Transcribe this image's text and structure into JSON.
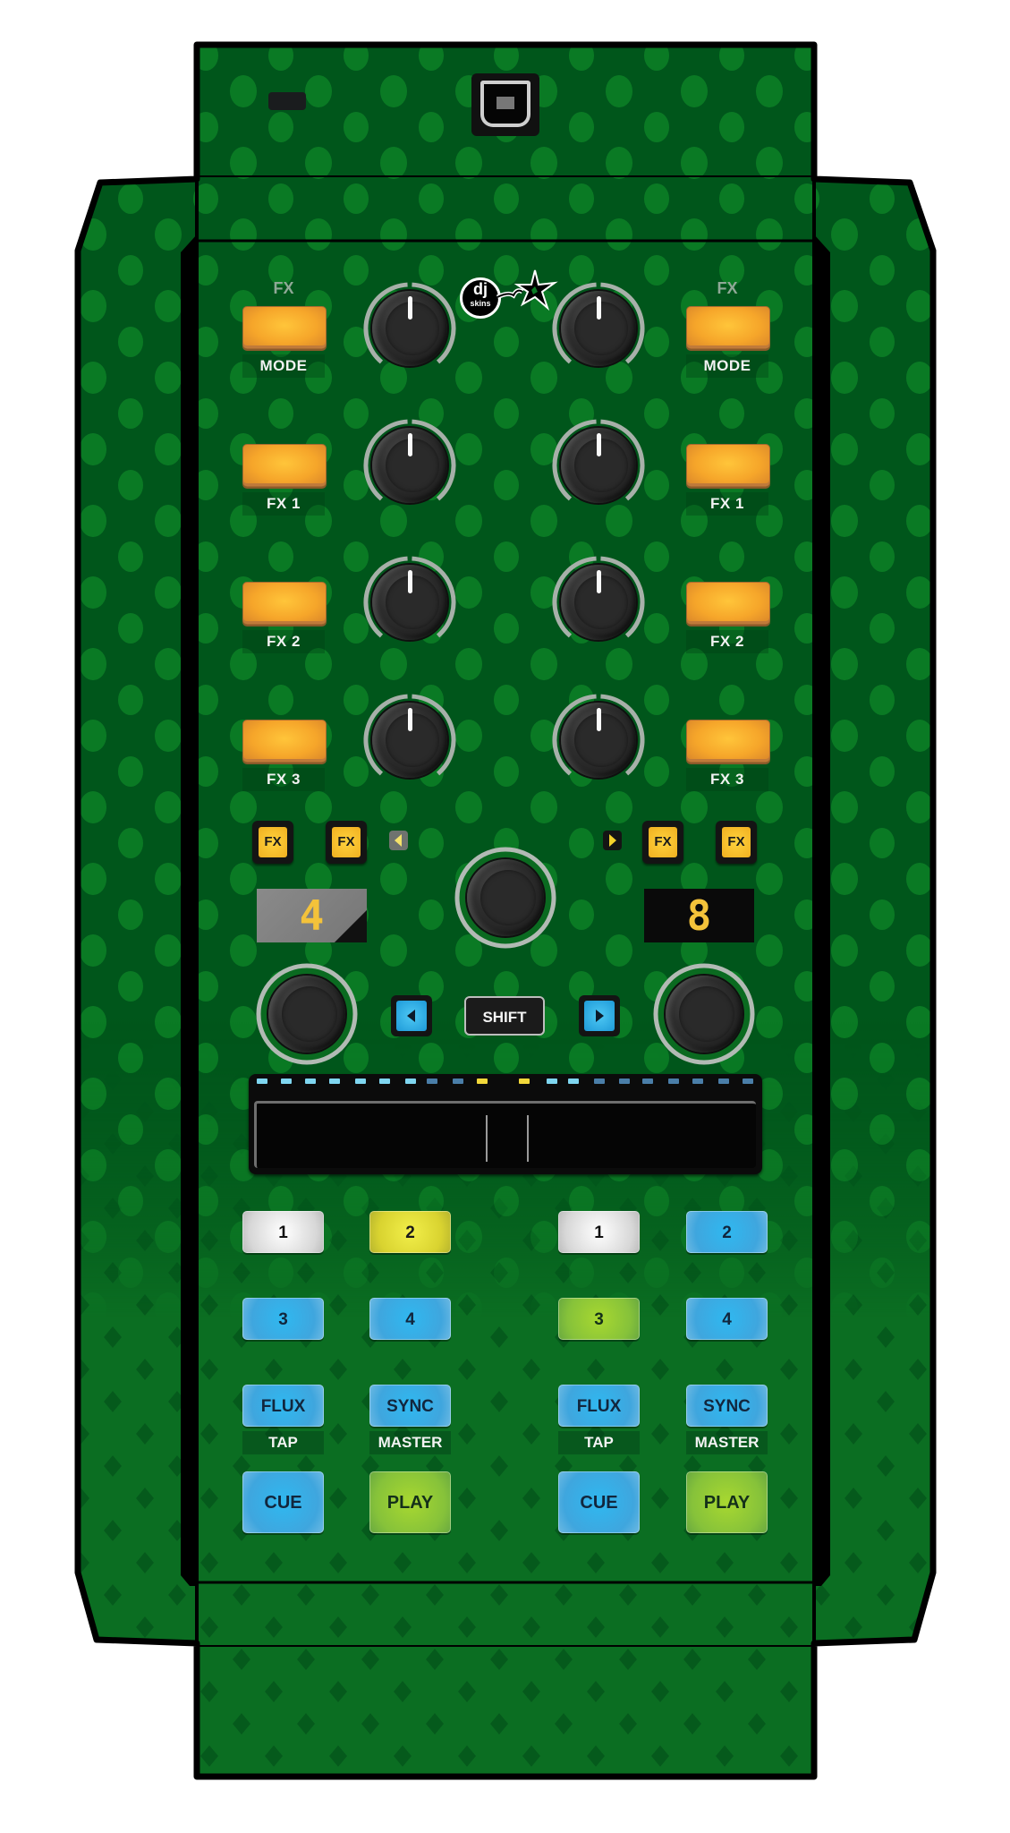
{
  "device": {
    "brand_logo": {
      "top": "dj",
      "bottom": "skins"
    },
    "theme": {
      "background": "#00561b",
      "dot": "#0a7a24",
      "lower_background": "#0b6e22",
      "diamond": "#055a1c"
    }
  },
  "top_panel": {
    "status_led": "led-slot",
    "usb_port": "usb-b-port-icon"
  },
  "fx_units": {
    "left": {
      "top_label": "FX",
      "buttons": [
        {
          "label": "MODE"
        },
        {
          "label": "FX 1"
        },
        {
          "label": "FX 2"
        },
        {
          "label": "FX 3"
        }
      ]
    },
    "right": {
      "top_label": "FX",
      "buttons": [
        {
          "label": "MODE"
        },
        {
          "label": "FX 1"
        },
        {
          "label": "FX 2"
        },
        {
          "label": "FX 3"
        }
      ]
    }
  },
  "fx_assign": {
    "left": [
      {
        "label": "FX"
      },
      {
        "label": "FX"
      }
    ],
    "right": [
      {
        "label": "FX"
      },
      {
        "label": "FX"
      }
    ],
    "left_indicator": "arrow-left-icon",
    "right_indicator": "arrow-right-icon"
  },
  "displays": {
    "left": "4",
    "right": "8"
  },
  "center": {
    "shift_label": "SHIFT"
  },
  "colors": {
    "orange": "#f6a62a",
    "yellow": "#f0b020",
    "blue": "#2fb8f0",
    "green": "#a8d830",
    "led_cyan": "#7fd6f0",
    "led_dim": "#4a7ea8",
    "led_yellow": "#f2d83a",
    "display_text": "#f3c23a"
  },
  "touch_strip": {
    "left_leds": [
      "cyan",
      "cyan",
      "cyan",
      "cyan",
      "cyan",
      "cyan",
      "cyan",
      "dim",
      "dim",
      "yellow"
    ],
    "right_leds": [
      "yellow",
      "cyan",
      "cyan",
      "dim",
      "dim",
      "dim",
      "dim",
      "dim",
      "dim",
      "dim"
    ]
  },
  "decks": {
    "left": {
      "hotcues": [
        {
          "label": "1",
          "color": "white"
        },
        {
          "label": "2",
          "color": "yellow"
        },
        {
          "label": "3",
          "color": "blue"
        },
        {
          "label": "4",
          "color": "blue"
        }
      ],
      "flux": {
        "label": "FLUX",
        "sub": "TAP"
      },
      "sync": {
        "label": "SYNC",
        "sub": "MASTER"
      },
      "cue": {
        "label": "CUE"
      },
      "play": {
        "label": "PLAY"
      }
    },
    "right": {
      "hotcues": [
        {
          "label": "1",
          "color": "white"
        },
        {
          "label": "2",
          "color": "blue"
        },
        {
          "label": "3",
          "color": "green"
        },
        {
          "label": "4",
          "color": "blue"
        }
      ],
      "flux": {
        "label": "FLUX",
        "sub": "TAP"
      },
      "sync": {
        "label": "SYNC",
        "sub": "MASTER"
      },
      "cue": {
        "label": "CUE"
      },
      "play": {
        "label": "PLAY"
      }
    }
  }
}
